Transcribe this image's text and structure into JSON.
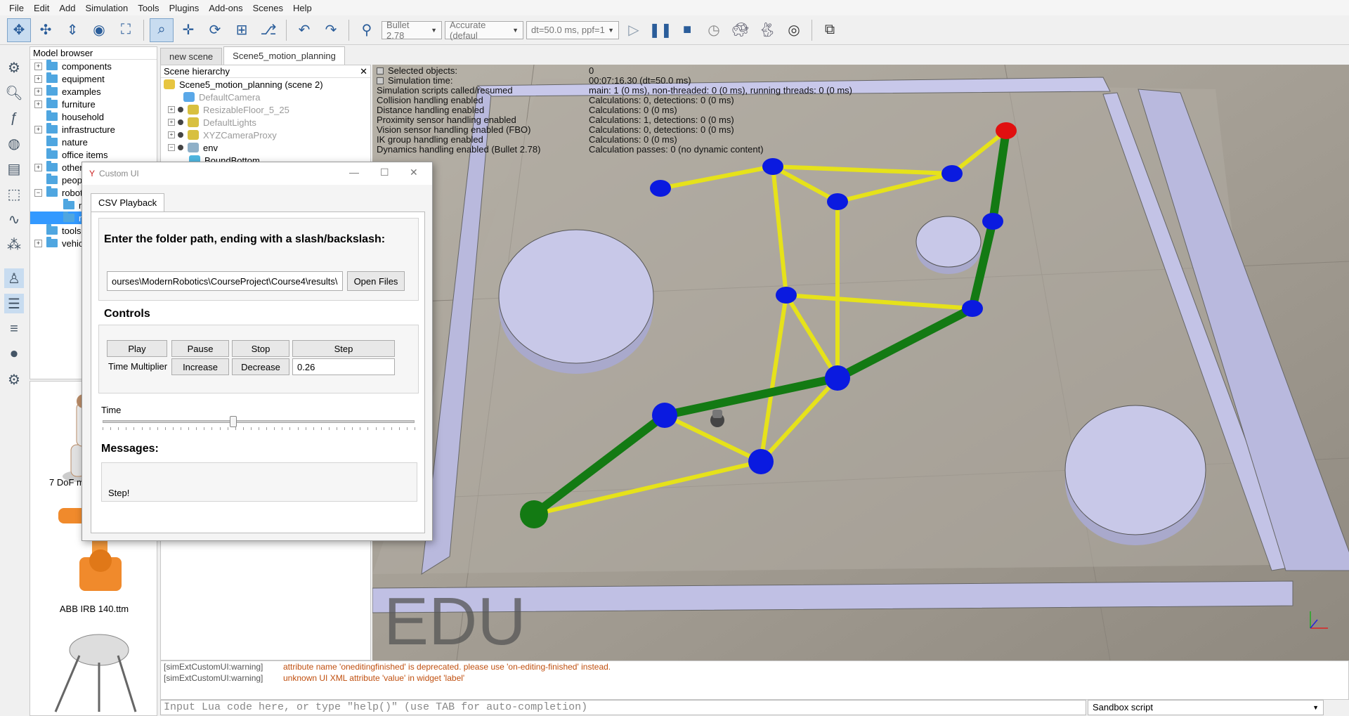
{
  "menu": [
    "File",
    "Edit",
    "Add",
    "Simulation",
    "Tools",
    "Plugins",
    "Add-ons",
    "Scenes",
    "Help"
  ],
  "toolbar": {
    "engine": "Bullet 2.78",
    "accuracy": "Accurate (defaul",
    "timestep": "dt=50.0 ms, ppf=1"
  },
  "model_browser": {
    "title": "Model browser",
    "items": [
      {
        "label": "components",
        "exp": "+"
      },
      {
        "label": "equipment",
        "exp": "+"
      },
      {
        "label": "examples",
        "exp": "+"
      },
      {
        "label": "furniture",
        "exp": "+"
      },
      {
        "label": "household",
        "exp": ""
      },
      {
        "label": "infrastructure",
        "exp": "+"
      },
      {
        "label": "nature",
        "exp": ""
      },
      {
        "label": "office items",
        "exp": ""
      },
      {
        "label": "other",
        "exp": "+"
      },
      {
        "label": "people",
        "exp": ""
      },
      {
        "label": "robots",
        "exp": "−"
      },
      {
        "label": "mobile",
        "exp": ""
      },
      {
        "label": "non-mobile",
        "exp": ""
      },
      {
        "label": "tools",
        "exp": ""
      },
      {
        "label": "vehicles",
        "exp": "+"
      }
    ],
    "thumbs": [
      "7 DoF manipulator.ttm",
      "ABB IRB 140.ttm"
    ]
  },
  "scene_tabs": [
    "new scene",
    "Scene5_motion_planning"
  ],
  "hierarchy": {
    "title": "Scene hierarchy",
    "rows": [
      {
        "label": "Scene5_motion_planning (scene 2)",
        "style": "root"
      },
      {
        "label": "DefaultCamera",
        "style": "faded"
      },
      {
        "label": "ResizableFloor_5_25",
        "style": "faded"
      },
      {
        "label": "DefaultLights",
        "style": "faded"
      },
      {
        "label": "XYZCameraProxy",
        "style": "faded"
      },
      {
        "label": "env",
        "style": "normal"
      },
      {
        "label": "BoundBottom",
        "style": "normal"
      }
    ]
  },
  "sim_info": {
    "labels": [
      "Selected objects:",
      "Simulation time:",
      "Simulation scripts called/resumed",
      "Collision handling enabled",
      "Distance handling enabled",
      "Proximity sensor handling enabled",
      "Vision sensor handling enabled (FBO)",
      "IK group handling enabled",
      "Dynamics handling enabled (Bullet 2.78)"
    ],
    "values": [
      "0",
      "00:07:16.30 (dt=50.0 ms)",
      "main: 1 (0 ms), non-threaded: 0 (0 ms), running threads: 0 (0 ms)",
      "Calculations: 0, detections: 0 (0 ms)",
      "Calculations: 0 (0 ms)",
      "Calculations: 1, detections: 0 (0 ms)",
      "Calculations: 0, detections: 0 (0 ms)",
      "Calculations: 0 (0 ms)",
      "Calculation passes: 0 (no dynamic content)"
    ]
  },
  "watermark": "EDU",
  "custom_ui": {
    "title": "Custom UI",
    "tab": "CSV Playback",
    "folder_heading": "Enter the folder path, ending with a slash/backslash:",
    "folder_value": "ourses\\ModernRobotics\\CourseProject\\Course4\\results\\",
    "open_files": "Open Files",
    "controls_heading": "Controls",
    "play": "Play",
    "pause": "Pause",
    "stop": "Stop",
    "step": "Step",
    "time_multiplier": "Time Multiplier",
    "increase": "Increase",
    "decrease": "Decrease",
    "multiplier_value": "0.26",
    "time_label": "Time",
    "time_fraction": 0.42,
    "messages_heading": "Messages:",
    "message": "Step!"
  },
  "console": [
    {
      "tag": "[simExtCustomUI:warning]",
      "msg": "attribute name 'oneditingfinished' is deprecated. please use 'on-editing-finished' instead."
    },
    {
      "tag": "[simExtCustomUI:warning]",
      "msg": "unknown UI XML attribute 'value' in widget 'label'"
    }
  ],
  "lua_placeholder": "Input Lua code here, or type \"help()\" (use TAB for auto-completion)",
  "script_select": "Sandbox script",
  "colors": {
    "path": "#137a13",
    "edge": "#e6e21a",
    "node": "#0a1ae0",
    "goal": "#e01010",
    "obstacle": "#c8c8e8"
  }
}
